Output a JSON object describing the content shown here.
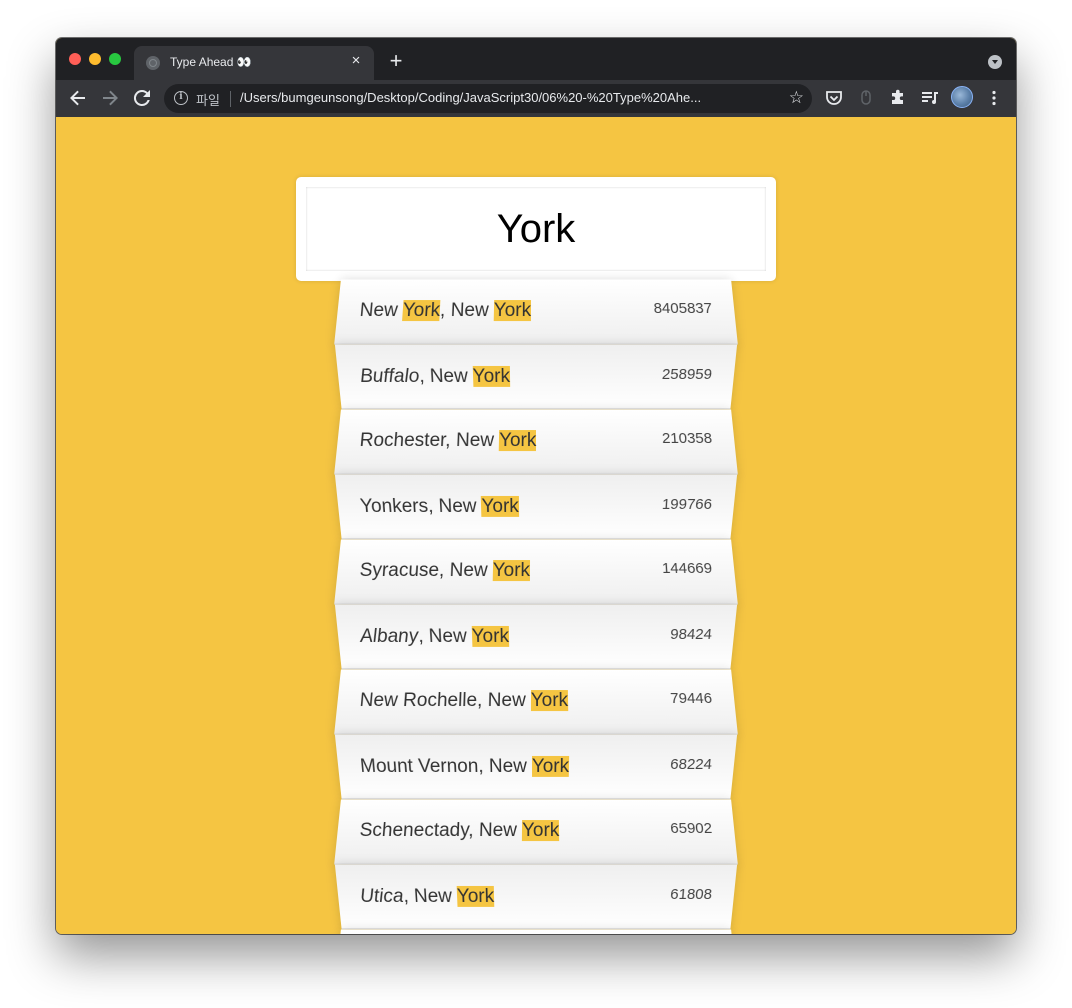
{
  "browser": {
    "tab_title": "Type Ahead 👀",
    "tab_close": "×",
    "new_tab": "+",
    "scheme_label": "파일",
    "url": "/Users/bumgeunsong/Desktop/Coding/JavaScript30/06%20-%20Type%20Ahe...",
    "icons": [
      "back-icon",
      "forward-icon",
      "reload-icon",
      "info-icon",
      "star-icon",
      "pocket-icon",
      "mouse-extension-icon",
      "extensions-puzzle-icon",
      "media-queue-icon",
      "profile-avatar",
      "kebab-menu-icon",
      "tab-search-icon"
    ]
  },
  "search": {
    "value": "York",
    "highlight_color": "#f5c542",
    "page_background": "#f5c542"
  },
  "suggestions": [
    {
      "parts": [
        {
          "t": "New "
        },
        {
          "t": "York",
          "hl": true
        },
        {
          "t": ", New "
        },
        {
          "t": "York",
          "hl": true
        }
      ],
      "population": "8405837",
      "italic": false
    },
    {
      "parts": [
        {
          "t": "Buffalo",
          "i": true
        },
        {
          "t": ", New "
        },
        {
          "t": "York",
          "hl": true
        }
      ],
      "population": "258959",
      "italic": false
    },
    {
      "parts": [
        {
          "t": "Rochester, New "
        },
        {
          "t": "York",
          "hl": true
        }
      ],
      "population": "210358",
      "italic": false
    },
    {
      "parts": [
        {
          "t": "Yonkers, New "
        },
        {
          "t": "York",
          "hl": true
        }
      ],
      "population": "199766",
      "italic": false
    },
    {
      "parts": [
        {
          "t": "Syracuse, New "
        },
        {
          "t": "York",
          "hl": true
        }
      ],
      "population": "144669",
      "italic": false
    },
    {
      "parts": [
        {
          "t": "Albany",
          "i": true
        },
        {
          "t": ", New "
        },
        {
          "t": "York",
          "hl": true
        }
      ],
      "population": "98424",
      "italic": false
    },
    {
      "parts": [
        {
          "t": "New Rochelle, New "
        },
        {
          "t": "York",
          "hl": true
        }
      ],
      "population": "79446",
      "italic": false
    },
    {
      "parts": [
        {
          "t": "Mount Vernon, New "
        },
        {
          "t": "York",
          "hl": true
        }
      ],
      "population": "68224",
      "italic": false
    },
    {
      "parts": [
        {
          "t": "Schenectady, New "
        },
        {
          "t": "York",
          "hl": true
        }
      ],
      "population": "65902",
      "italic": false
    },
    {
      "parts": [
        {
          "t": "Utica",
          "i": true
        },
        {
          "t": ", New "
        },
        {
          "t": "York",
          "hl": true
        }
      ],
      "population": "61808",
      "italic": false
    },
    {
      "parts": [],
      "population": "",
      "italic": false
    }
  ]
}
